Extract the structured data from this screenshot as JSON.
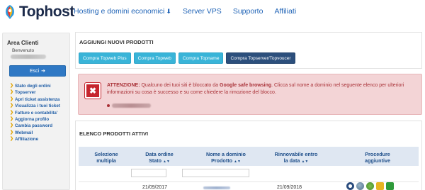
{
  "brand": {
    "logo_text": "Tophost"
  },
  "nav": {
    "items": [
      {
        "label": "Hosting e domini economici",
        "has_caret": true
      },
      {
        "label": "Server VPS"
      },
      {
        "label": "Supporto"
      },
      {
        "label": "Affiliati"
      }
    ]
  },
  "sidebar": {
    "title": "Area Clienti",
    "welcome": "Benvenuto",
    "exit_label": "Esci",
    "items": [
      {
        "label": "Stato degli ordini"
      },
      {
        "label": "Topserver"
      },
      {
        "label": "Apri ticket assistenza"
      },
      {
        "label": "Visualizza i tuoi ticket"
      },
      {
        "label": "Fatture e contabilita'"
      },
      {
        "label": "Aggiorna profilo"
      },
      {
        "label": "Cambia password"
      },
      {
        "label": "Webmail"
      },
      {
        "label": "Affiliazione"
      }
    ]
  },
  "add_products": {
    "heading": "AGGIUNGI NUOVI PRODOTTI",
    "buttons": [
      {
        "label": "Compra Topweb Plus"
      },
      {
        "label": "Compra Topweb"
      },
      {
        "label": "Compra Topname"
      },
      {
        "label": "Compra Topserver/Topvoucer"
      }
    ]
  },
  "alert": {
    "prefix": "ATTENZIONE:",
    "text_before": " Qualcuno dei tuoi siti è bloccato da ",
    "bold_term": "Google safe browsing",
    "text_after": ". Clicca sul nome a dominio nel seguente elenco per ulteriori informazioni su cosa è successo e su come chiedere la rimozione del blocco."
  },
  "active_products": {
    "heading": "ELENCO PRODOTTI ATTIVI",
    "columns": {
      "c1a": "Selezione",
      "c1b": "multipla",
      "c2a": "Data ordine",
      "c2b": "Stato",
      "c3a": "Nome a dominio",
      "c3b": "Prodotto",
      "c4a": "Rinnovabile entro",
      "c4b": "la data",
      "c5a": "Procedure",
      "c5b": "aggiuntive"
    },
    "rows": [
      {
        "order_date": "21/09/2017",
        "renew_date": "21/09/2018"
      }
    ]
  },
  "colors": {
    "nav_link": "#1f63b6",
    "button_primary": "#39b4d8",
    "button_dark": "#2c4f7c",
    "alert_bg": "#f3d4d6",
    "alert_text": "#a83036",
    "table_header_bg": "#dfe7f2"
  }
}
